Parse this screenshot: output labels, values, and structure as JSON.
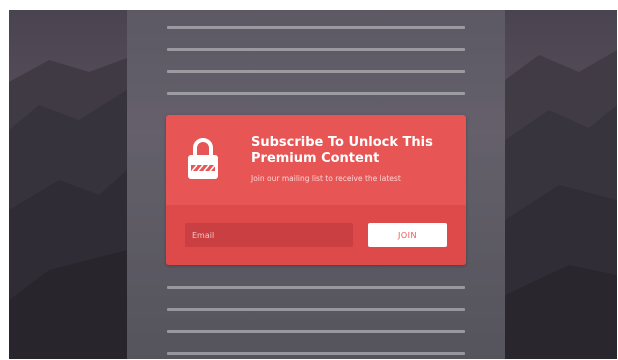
{
  "modal": {
    "title": "Subscribe To Unlock This Premium Content",
    "subtitle": "Join our mailing list to receive the latest",
    "email_placeholder": "Email",
    "join_label": "JOIN"
  },
  "icons": {
    "lock": "lock-icon"
  },
  "colors": {
    "accent": "#e85555",
    "accent_dark": "#de4a4a",
    "input_bg": "#c93f42",
    "overlay": "#6a6670"
  }
}
